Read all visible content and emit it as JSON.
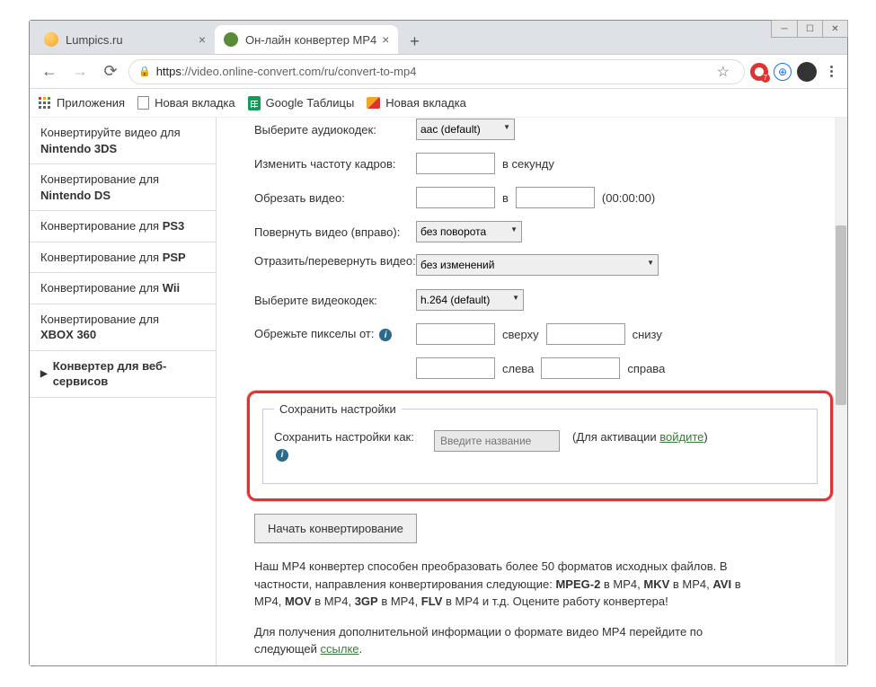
{
  "window": {
    "tabs": [
      {
        "title": "Lumpics.ru"
      },
      {
        "title": "Он-лайн конвертер MP4"
      }
    ],
    "url_host": "https",
    "url_domain": "://video.online-convert.com",
    "url_path": "/ru/convert-to-mp4",
    "ext_badge": "7"
  },
  "bookmarks": {
    "apps": "Приложения",
    "newtab1": "Новая вкладка",
    "sheets": "Google Таблицы",
    "newtab2": "Новая вкладка"
  },
  "sidebar": {
    "items": [
      {
        "pre": "Конвертируйте видео для",
        "bold": "Nintendo 3DS"
      },
      {
        "pre": "Конвертирование для",
        "bold": "Nintendo DS"
      },
      {
        "pre": "Конвертирование для ",
        "bold": "PS3"
      },
      {
        "pre": "Конвертирование для ",
        "bold": "PSP"
      },
      {
        "pre": "Конвертирование для ",
        "bold": "Wii"
      },
      {
        "pre": "Конвертирование для",
        "bold": "XBOX 360"
      }
    ],
    "header": "Конвертер для веб-сервисов"
  },
  "form": {
    "audio_codec_lbl": "Выберите аудиокодек:",
    "audio_codec_val": "aac (default)",
    "fps_lbl": "Изменить частоту кадров:",
    "fps_unit": "в секунду",
    "trim_lbl": "Обрезать видео:",
    "trim_sep": "в",
    "trim_hint": "(00:00:00)",
    "rotate_lbl": "Повернуть видео (вправо):",
    "rotate_val": "без поворота",
    "flip_lbl": "Отразить/перевернуть видео:",
    "flip_val": "без изменений",
    "vcodec_lbl": "Выберите видеокодек:",
    "vcodec_val": "h.264 (default)",
    "crop_lbl": "Обрежьте пикселы от:",
    "crop_top": "сверху",
    "crop_bottom": "снизу",
    "crop_left": "слева",
    "crop_right": "справа"
  },
  "save": {
    "legend": "Сохранить настройки",
    "label": "Сохранить настройки как:",
    "placeholder": "Введите название",
    "hint_pre": "(Для активации ",
    "hint_link": "войдите",
    "hint_post": ")"
  },
  "start_btn": "Начать конвертирование",
  "desc": {
    "p1a": "Наш MP4 конвертер способен преобразовать более 50 форматов исходных файлов. В частности, направления конвертирования следующие: ",
    "p1b": " в MP4, ",
    "p1c": " в MP4, ",
    "p1d": " в MP4, ",
    "p1e": " в MP4, ",
    "p1f": " в MP4, ",
    "p1g": " в MP4 и т.д. Оцените работу конвертера!",
    "f1": "MPEG-2",
    "f2": "MKV",
    "f3": "AVI",
    "f4": "MOV",
    "f5": "3GP",
    "f6": "FLV",
    "p2a": "Для получения дополнительной информации о формате видео MP4 перейдите по следующей ",
    "p2link": "ссылке",
    "p2b": "."
  }
}
